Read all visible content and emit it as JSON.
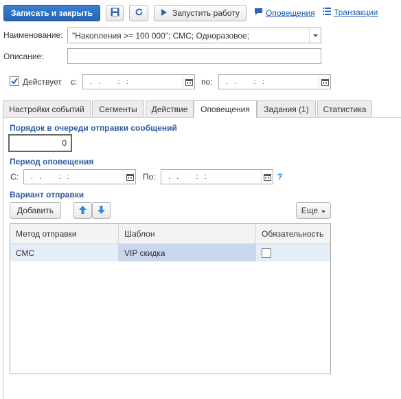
{
  "toolbar": {
    "save_close": "Записать и закрыть",
    "run": "Запустить работу",
    "notifications": "Оповещения",
    "transactions": "Транзакции"
  },
  "form": {
    "name_label": "Наименование:",
    "name_value": "\"Накопления >= 100 000\"; СМС; Одноразовое;",
    "description_label": "Описание:",
    "description_value": "",
    "active_label": "Действует",
    "active_checked": true,
    "from_label": "с:",
    "to_label": "по:",
    "date_from": ".  .      :  :",
    "date_to": ".  .      :  :"
  },
  "tabs": [
    {
      "label": "Настройки событий",
      "active": false
    },
    {
      "label": "Сегменты",
      "active": false
    },
    {
      "label": "Действие",
      "active": false
    },
    {
      "label": "Оповещения",
      "active": true
    },
    {
      "label": "Задания (1)",
      "active": false
    },
    {
      "label": "Статистика",
      "active": false
    }
  ],
  "notifications": {
    "queue_title": "Порядок в очереди отправки сообщений",
    "queue_value": "0",
    "period_title": "Период оповещения",
    "period_from_label": "С:",
    "period_to_label": "По:",
    "period_from": ".  .      :  :",
    "period_to": ".  .      :  :",
    "help": "?",
    "variant_title": "Вариант отправки",
    "add_label": "Добавить",
    "more_label": "Еще"
  },
  "grid": {
    "columns": [
      "Метод отправки",
      "Шаблон",
      "Обязательность"
    ],
    "rows": [
      {
        "method": "СМС",
        "template": "VIP скидка",
        "required": false
      }
    ]
  },
  "colors": {
    "accent": "#2a64b4",
    "link": "#1a5bb0",
    "section_title": "#2c5aa0",
    "selected_row": "#e5eef8"
  }
}
